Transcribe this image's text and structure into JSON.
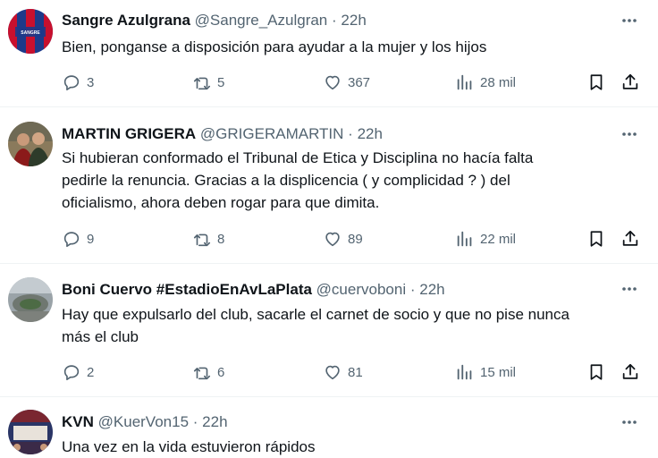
{
  "tweets": [
    {
      "name": "Sangre Azulgrana",
      "handle": "@Sangre_Azulgran",
      "separator": "·",
      "time": "22h",
      "lines": [
        "Bien, ponganse a disposición para ayudar a la mujer y los hijos"
      ],
      "replies": "3",
      "retweets": "5",
      "likes": "367",
      "views": "28 mil",
      "avatar_label": "SANGRE AZULGRANA"
    },
    {
      "name": "MARTIN GRIGERA",
      "handle": "@GRIGERAMARTIN",
      "separator": "·",
      "time": "22h",
      "lines": [
        "Si hubieran conformado el Tribunal de Etica y Disciplina no hacía falta",
        "pedirle la renuncia. Gracias a la displicencia ( y complicidad ? ) del",
        "oficialismo, ahora deben rogar para que dimita."
      ],
      "replies": "9",
      "retweets": "8",
      "likes": "89",
      "views": "22 mil"
    },
    {
      "name": "Boni Cuervo #EstadioEnAvLaPlata",
      "handle": "@cuervoboni",
      "separator": "·",
      "time": "22h",
      "lines": [
        "Hay que expulsarlo del club, sacarle el carnet de socio y que no pise nunca",
        "más el club"
      ],
      "replies": "2",
      "retweets": "6",
      "likes": "81",
      "views": "15 mil"
    },
    {
      "name": "KVN",
      "handle": "@KuerVon15",
      "separator": "·",
      "time": "22h",
      "lines": [
        "Una vez en la vida estuvieron rápidos"
      ]
    }
  ],
  "icons": {
    "more": "more-horizontal-icon",
    "reply": "reply-icon",
    "retweet": "retweet-icon",
    "like": "heart-icon",
    "views": "views-bar-chart-icon",
    "bookmark": "bookmark-icon",
    "share": "share-icon"
  },
  "colors": {
    "text": "#0f1419",
    "secondary": "#536471",
    "divider": "#eff3f4",
    "avatar_blue": "#1d3a8a",
    "avatar_red": "#c8102e"
  }
}
